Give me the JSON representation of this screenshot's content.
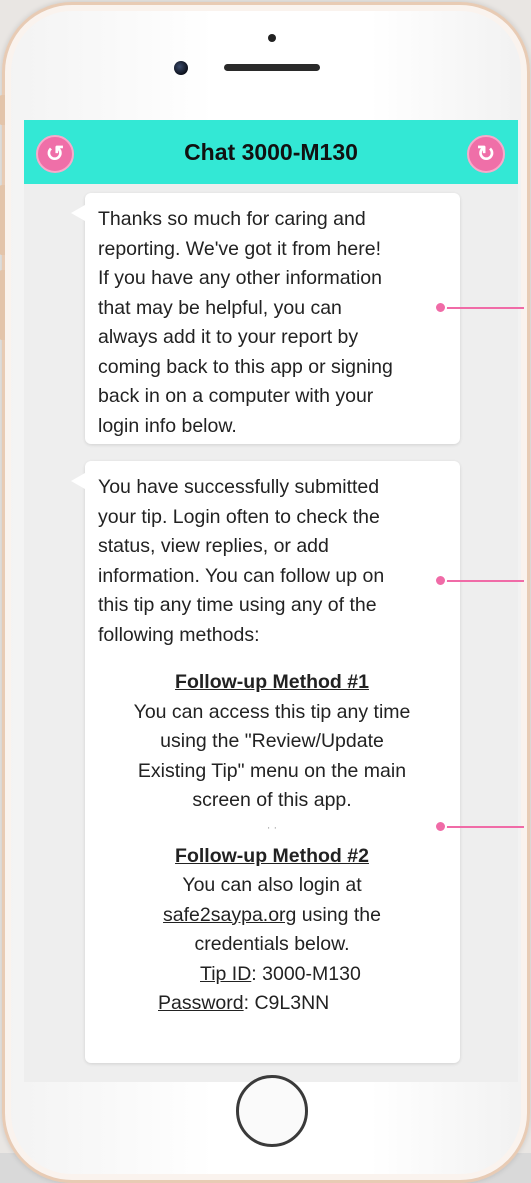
{
  "header": {
    "title": "Chat 3000-M130",
    "back_glyph": "↺",
    "refresh_glyph": "↻"
  },
  "messages": [
    {
      "lines": [
        "Thanks so much for caring and",
        "reporting. We've got it from here!",
        "If you have any other information",
        "that may be helpful, you can",
        "always add it to your report by",
        "coming back to this app or signing",
        "back in on a computer with your",
        "login info below."
      ]
    },
    {
      "intro_lines": [
        "You have successfully submitted",
        "your tip. Login often to check the",
        "status, view replies, or add",
        "information. You can follow up on",
        "this tip any time using any of the",
        "following methods:"
      ],
      "method1": {
        "title": "Follow-up Method #1",
        "lines": [
          "You can access this tip any time",
          "using the \"Review/Update",
          "Existing Tip\" menu on the main",
          "screen of this app."
        ]
      },
      "separator": "· ·",
      "method2": {
        "title": "Follow-up Method #2",
        "line1": "You can also login at",
        "link": "safe2saypa.org",
        "link_suffix": " using the",
        "line3": "credentials below.",
        "tip_id_label": "Tip ID",
        "tip_id_value": ": 3000-M130",
        "password_label": "Password",
        "password_value": ": C9L3NN"
      }
    }
  ],
  "colors": {
    "header": "#33e8d5",
    "accent": "#ef6fa8",
    "pointer": "#f06ba7"
  }
}
